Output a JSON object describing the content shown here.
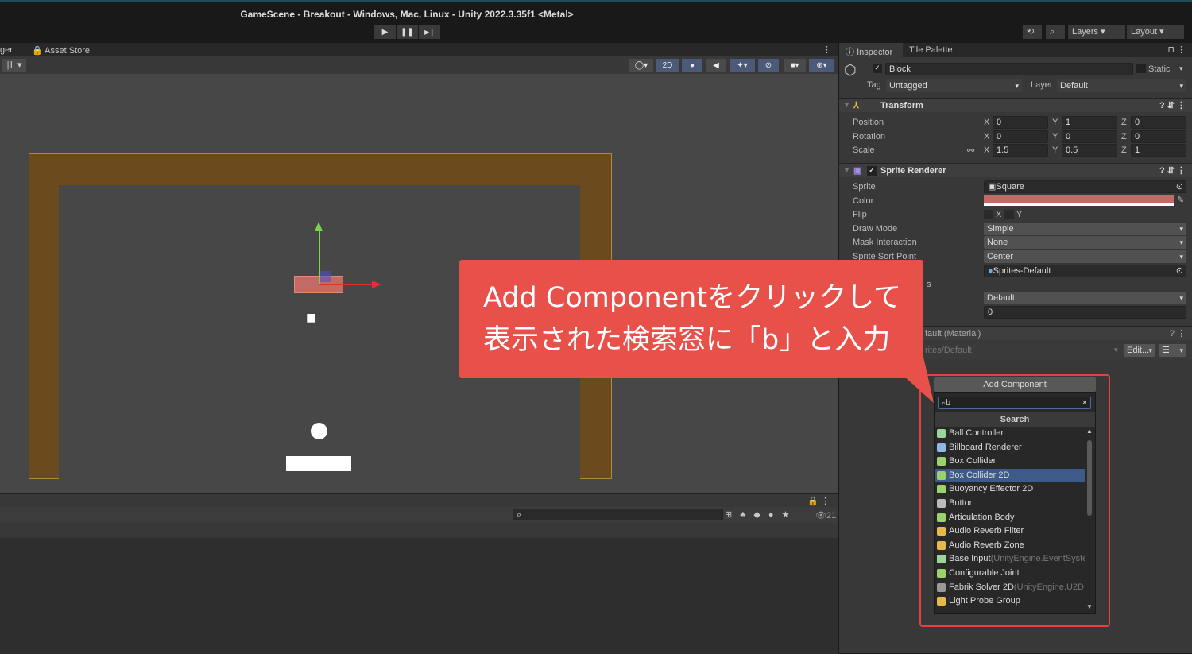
{
  "window": {
    "title": "GameScene - Breakout - Windows, Mac, Linux - Unity 2022.3.35f1 <Metal>"
  },
  "toolbar": {
    "play": "▶",
    "pause": "❚❚",
    "step": "▶❙",
    "history_icon": "history-icon",
    "search_icon": "search-icon",
    "layers": "Layers",
    "layout": "Layout"
  },
  "tabs": {
    "left_partial": "ger",
    "asset_store": "Asset Store"
  },
  "scene_toolbar": {
    "mode_2d": "2D"
  },
  "bottom": {
    "count": "21"
  },
  "inspector": {
    "tabs": [
      "Inspector",
      "Tile Palette"
    ],
    "object": {
      "name": "Block",
      "active": true,
      "static_label": "Static",
      "tag_label": "Tag",
      "tag": "Untagged",
      "layer_label": "Layer",
      "layer": "Default"
    },
    "transform": {
      "title": "Transform",
      "rows": [
        {
          "label": "Position",
          "x": "0",
          "y": "1",
          "z": "0"
        },
        {
          "label": "Rotation",
          "x": "0",
          "y": "0",
          "z": "0"
        },
        {
          "label": "Scale",
          "x": "1.5",
          "y": "0.5",
          "z": "1"
        }
      ]
    },
    "sprite_renderer": {
      "title": "Sprite Renderer",
      "sprite_label": "Sprite",
      "sprite": "Square",
      "color_label": "Color",
      "color": "#c46a66",
      "flip_label": "Flip",
      "flip_x": "X",
      "flip_y": "Y",
      "draw_mode_label": "Draw Mode",
      "draw_mode": "Simple",
      "mask_label": "Mask Interaction",
      "mask": "None",
      "sort_label": "Sprite Sort Point",
      "sort": "Center",
      "material": "Sprites-Default",
      "partial_s": "s",
      "sorting_layer": "Default",
      "order": "0"
    },
    "material": {
      "title_partial": "fault (Material)",
      "shader_partial": "rites/Default",
      "edit": "Edit..."
    },
    "add_component": {
      "button": "Add Component",
      "search_value": "b",
      "search_header": "Search",
      "items": [
        {
          "label": "Ball Controller",
          "ns": "",
          "color": "#9ad59a"
        },
        {
          "label": "Billboard Renderer",
          "ns": "",
          "color": "#8fb7e8"
        },
        {
          "label": "Box Collider",
          "ns": "",
          "color": "#9bd36a"
        },
        {
          "label": "Box Collider 2D",
          "ns": "",
          "color": "#9bd36a",
          "selected": true
        },
        {
          "label": "Buoyancy Effector 2D",
          "ns": "",
          "color": "#9bd36a"
        },
        {
          "label": "Button",
          "ns": "",
          "color": "#bbbbbb"
        },
        {
          "label": "Articulation Body",
          "ns": "",
          "color": "#9bd36a"
        },
        {
          "label": "Audio Reverb Filter",
          "ns": "",
          "color": "#e8b84a"
        },
        {
          "label": "Audio Reverb Zone",
          "ns": "",
          "color": "#e8b84a"
        },
        {
          "label": "Base Input",
          "ns": "(UnityEngine.EventSyste",
          "color": "#9ad59a"
        },
        {
          "label": "Configurable Joint",
          "ns": "",
          "color": "#9bd36a"
        },
        {
          "label": "Fabrik Solver 2D",
          "ns": "(UnityEngine.U2D.",
          "color": "#999999"
        },
        {
          "label": "Light Probe Group",
          "ns": "",
          "color": "#e8b84a"
        }
      ]
    }
  },
  "annotation": {
    "line1": "Add Componentをクリックして",
    "line2": "表示された検索窓に「b」と入力",
    "color": "#e8504a"
  }
}
